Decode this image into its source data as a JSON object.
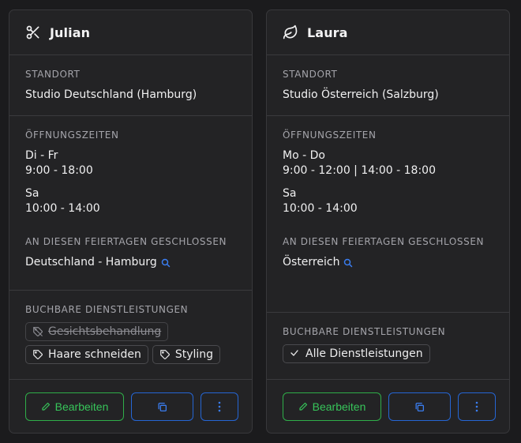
{
  "labels": {
    "location": "STANDORT",
    "hours": "ÖFFNUNGSZEITEN",
    "holidays": "AN DIESEN FEIERTAGEN GESCHLOSSEN",
    "services": "BUCHBARE DIENSTLEISTUNGEN",
    "edit_button": "Bearbeiten"
  },
  "colors": {
    "edit_green": "#37c55a",
    "action_blue": "#2566d4",
    "search_blue": "#3a7df0"
  },
  "cards": [
    {
      "name": "Julian",
      "icon": "scissors-icon",
      "location": "Studio Deutschland (Hamburg)",
      "hours": [
        {
          "days": "Di - Fr",
          "times": "9:00 - 18:00"
        },
        {
          "days": "Sa",
          "times": "10:00 - 14:00"
        }
      ],
      "holidays": "Deutschland - Hamburg",
      "services": [
        {
          "label": "Gesichtsbehandlung",
          "icon": "tag-icon",
          "disabled": true
        },
        {
          "label": "Haare schneiden",
          "icon": "tag-icon",
          "disabled": false
        },
        {
          "label": "Styling",
          "icon": "tag-icon",
          "disabled": false
        }
      ]
    },
    {
      "name": "Laura",
      "icon": "leaf-icon",
      "location": "Studio Österreich (Salzburg)",
      "hours": [
        {
          "days": "Mo - Do",
          "times": "9:00 - 12:00 | 14:00 - 18:00"
        },
        {
          "days": "Sa",
          "times": "10:00 - 14:00"
        }
      ],
      "holidays": "Österreich",
      "services": [
        {
          "label": "Alle Dienstleistungen",
          "icon": "check-icon",
          "disabled": false
        }
      ]
    }
  ]
}
